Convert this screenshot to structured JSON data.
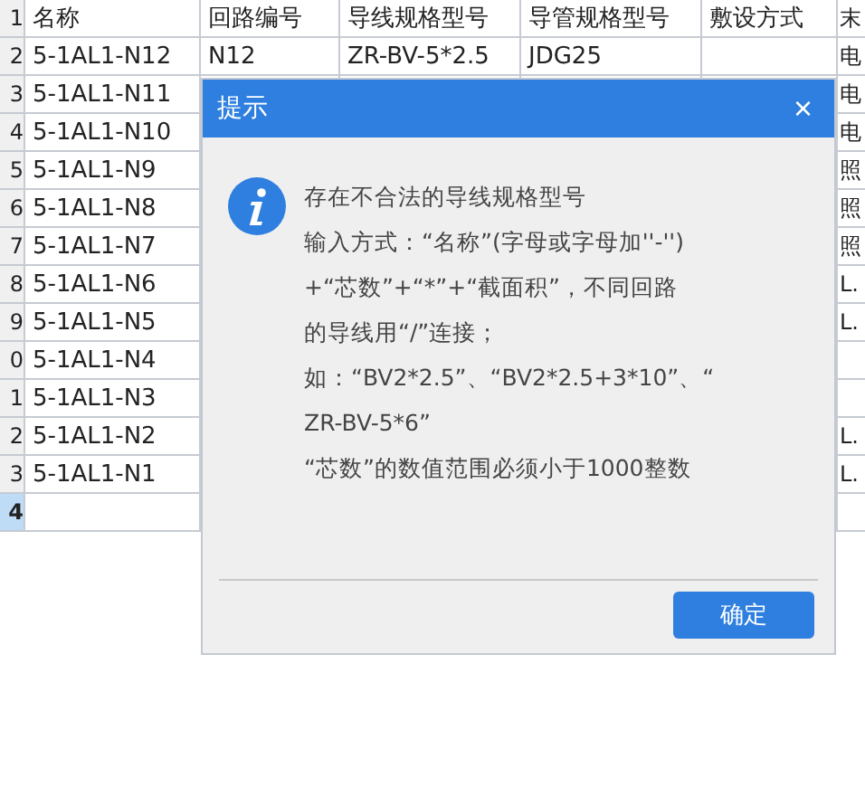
{
  "sheet": {
    "rows": [
      {
        "number": "1",
        "selected": false,
        "cells": [
          {
            "text": "名称"
          },
          {
            "text": "回路编号"
          },
          {
            "text": "导线规格型号"
          },
          {
            "text": "导管规格型号"
          },
          {
            "text": "敷设方式"
          },
          {
            "text": "末"
          }
        ]
      },
      {
        "number": "2",
        "selected": false,
        "cells": [
          {
            "text": "5-1AL1-N12"
          },
          {
            "text": "N12"
          },
          {
            "text": "ZR-BV-5*2.5"
          },
          {
            "text": "JDG25"
          },
          {},
          {
            "text": "电"
          }
        ]
      },
      {
        "number": "3",
        "selected": false,
        "cells": [
          {
            "text": "5-1AL1-N11"
          },
          {},
          {},
          {},
          {},
          {
            "text": "电"
          }
        ]
      },
      {
        "number": "4",
        "selected": false,
        "cells": [
          {
            "text": "5-1AL1-N10"
          },
          {},
          {},
          {},
          {},
          {
            "text": "电"
          }
        ]
      },
      {
        "number": "5",
        "selected": false,
        "cells": [
          {
            "text": "5-1AL1-N9"
          },
          {},
          {},
          {},
          {},
          {
            "text": "照"
          }
        ]
      },
      {
        "number": "6",
        "selected": false,
        "cells": [
          {
            "text": "5-1AL1-N8"
          },
          {},
          {},
          {},
          {},
          {
            "text": "照"
          }
        ]
      },
      {
        "number": "7",
        "selected": false,
        "cells": [
          {
            "text": "5-1AL1-N7"
          },
          {},
          {},
          {},
          {},
          {
            "text": "照"
          }
        ]
      },
      {
        "number": "8",
        "selected": false,
        "cells": [
          {
            "text": "5-1AL1-N6"
          },
          {},
          {},
          {},
          {},
          {
            "text": "L."
          }
        ]
      },
      {
        "number": "9",
        "selected": false,
        "cells": [
          {
            "text": "5-1AL1-N5"
          },
          {},
          {},
          {},
          {},
          {
            "text": "L."
          }
        ]
      },
      {
        "number": "0",
        "selected": false,
        "cells": [
          {
            "text": "5-1AL1-N4"
          },
          {},
          {},
          {},
          {},
          {}
        ]
      },
      {
        "number": "1",
        "selected": false,
        "cells": [
          {
            "text": "5-1AL1-N3"
          },
          {},
          {},
          {},
          {},
          {}
        ]
      },
      {
        "number": "2",
        "selected": false,
        "cells": [
          {
            "text": "5-1AL1-N2"
          },
          {},
          {},
          {},
          {},
          {
            "text": "L."
          }
        ]
      },
      {
        "number": "3",
        "selected": false,
        "cells": [
          {
            "text": "5-1AL1-N1"
          },
          {},
          {},
          {},
          {},
          {
            "text": "L."
          }
        ]
      },
      {
        "number": "4",
        "selected": true,
        "cells": [
          {},
          {},
          {},
          {},
          {},
          {}
        ]
      }
    ]
  },
  "dialog": {
    "title": "提示",
    "close": "×",
    "message_lines": [
      "存在不合法的导线规格型号",
      "输入方式：“名称”(字母或字母加''-'')",
      "+“芯数”+“*”+“截面积”，不同回路",
      "的导线用“/”连接；",
      "如：“BV2*2.5”、“BV2*2.5+3*10”、“",
      "ZR-BV-5*6”",
      " “芯数”的数值范围必须小于1000整数"
    ],
    "ok_button": "确定"
  }
}
